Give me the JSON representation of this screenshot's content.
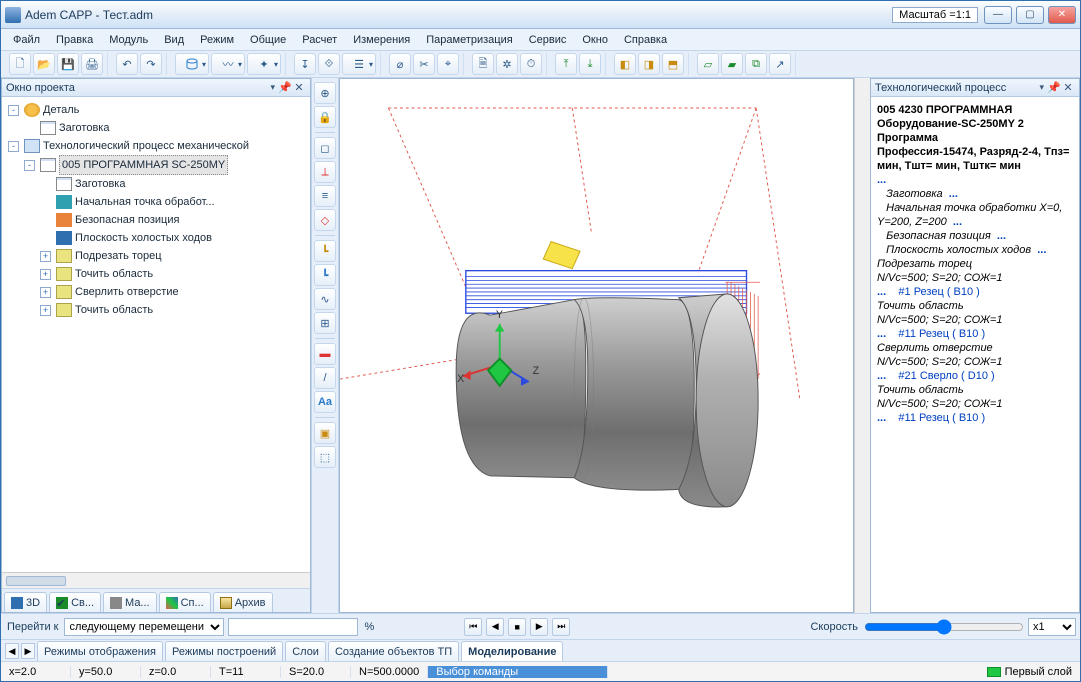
{
  "titlebar": {
    "title": "Adem CAPP - Тест.adm",
    "scale": "Масштаб =1:1"
  },
  "menu": [
    "Файл",
    "Правка",
    "Модуль",
    "Вид",
    "Режим",
    "Общие",
    "Расчет",
    "Измерения",
    "Параметризация",
    "Сервис",
    "Окно",
    "Справка"
  ],
  "leftPanel": {
    "title": "Окно проекта",
    "tabs": [
      {
        "label": "3D"
      },
      {
        "label": "Св..."
      },
      {
        "label": "Ма..."
      },
      {
        "label": "Сп..."
      },
      {
        "label": "Архив"
      }
    ]
  },
  "tree": {
    "items": [
      {
        "exp": "-",
        "icon": "ic-gear",
        "label": "Деталь",
        "children": [
          {
            "icon": "ic-doc",
            "label": "Заготовка"
          }
        ]
      },
      {
        "exp": "-",
        "icon": "ic-proc",
        "label": "Технологический процесс механической",
        "children": [
          {
            "exp": "-",
            "icon": "ic-doc",
            "label": "005  ПРОГРАММНАЯ SC-250MY",
            "selected": true,
            "children": [
              {
                "icon": "ic-doc",
                "label": "Заготовка"
              },
              {
                "icon": "ic-teal",
                "label": "Начальная точка обработ..."
              },
              {
                "icon": "ic-orange",
                "label": "Безопасная позиция"
              },
              {
                "icon": "ic-blue",
                "label": "Плоскость холостых ходов"
              },
              {
                "exp": "+",
                "icon": "ic-node",
                "label": "Подрезать торец"
              },
              {
                "exp": "+",
                "icon": "ic-node",
                "label": "Точить область"
              },
              {
                "exp": "+",
                "icon": "ic-node",
                "label": "Сверлить отверстие"
              },
              {
                "exp": "+",
                "icon": "ic-node",
                "label": "Точить область"
              }
            ]
          }
        ]
      }
    ]
  },
  "rightPanel": {
    "title": "Технологический процесс"
  },
  "process": {
    "head1": "005   4230 ПРОГРАММНАЯ",
    "head2": "Оборудование-SC-250MY   2",
    "head3": "Программа",
    "head4": "Профессия-15474, Разряд-2-4, Tпз= мин,  Tшт= мин,  Tштк= мин",
    "l_zagotovka": "Заготовка",
    "l_start": "Начальная точка обработки X=0, Y=200, Z=200",
    "l_safe": "Безопасная позиция",
    "l_plane": "Плоскость холостых ходов",
    "op1": "Подрезать торец",
    "op1p": "N/Vс=500; S=20; СОЖ=1",
    "t1": "#1 Резец ( В10 )",
    "op2": "Точить область",
    "op2p": "N/Vс=500; S=20; СОЖ=1",
    "t2": "#11 Резец ( В10 )",
    "op3": "Сверлить отверстие",
    "op3p": "N/Vс=500; S=20; СОЖ=1",
    "t3": "#21 Сверло ( D10 )",
    "op4": "Точить область",
    "op4p": "N/Vс=500; S=20; СОЖ=1",
    "t4": "#11 Резец ( В10 )",
    "dots": "..."
  },
  "nav": {
    "goto": "Перейти к",
    "gotoSel": "следующему перемещени",
    "pct": "%",
    "speed": "Скорость",
    "x1": "x1"
  },
  "bottomTabs": [
    "Режимы отображения",
    "Режимы построений",
    "Слои",
    "Создание объектов ТП",
    "Моделирование"
  ],
  "status": {
    "x": "x=2.0",
    "y": "y=50.0",
    "z": "z=0.0",
    "t": "T=11",
    "s": "S=20.0",
    "n": "N=500.0000",
    "cmd": "Выбор команды",
    "layer": "Первый слой"
  },
  "axes": {
    "x": "X",
    "y": "Y",
    "z": "Z"
  }
}
